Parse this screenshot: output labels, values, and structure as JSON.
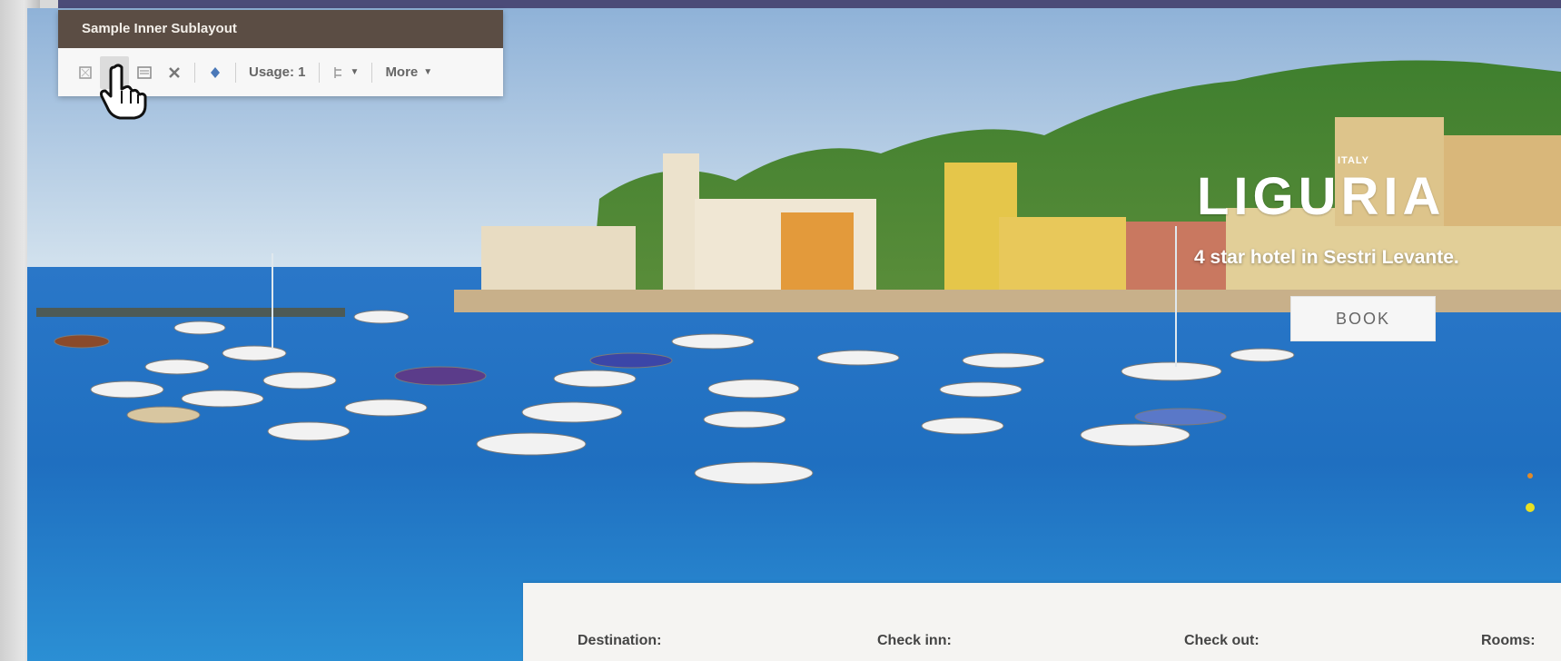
{
  "sublayout": {
    "title": "Sample Inner Sublayout",
    "usage_label": "Usage: 1",
    "more_label": "More"
  },
  "hero": {
    "kicker": "ITALY",
    "title": "LIGURIA",
    "subtitle": "4 star hotel in Sestri Levante.",
    "book_label": "BOOK"
  },
  "booking": {
    "destination_label": "Destination:",
    "checkin_label": "Check inn:",
    "checkout_label": "Check out:",
    "rooms_label": "Rooms:"
  },
  "colors": {
    "chrome_title_bg": "#5b4d44",
    "top_accent": "#4b4b78",
    "sea": "#1f6fc0",
    "sky": "#b9d2e6"
  },
  "icons": [
    "select-icon",
    "hand-cursor-icon",
    "edit-icon",
    "delete-icon",
    "move-icon",
    "datasource-icon"
  ]
}
